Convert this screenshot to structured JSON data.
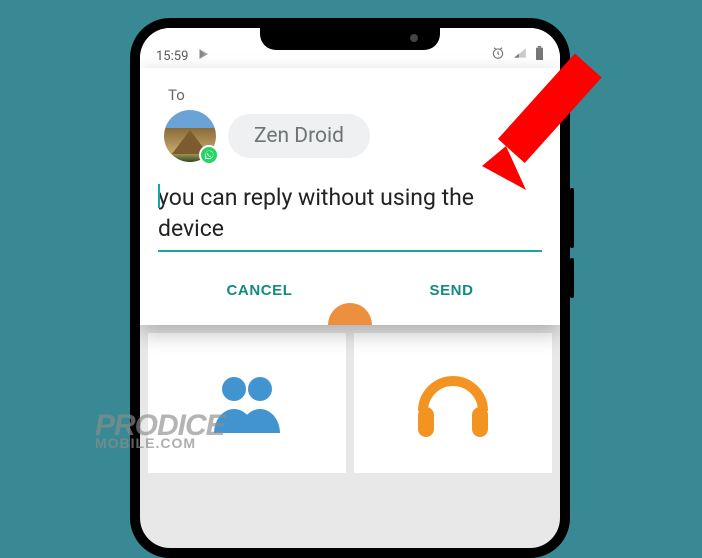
{
  "status_bar": {
    "time": "15:59",
    "alarm_on": true,
    "signal_icon": "signal",
    "battery_icon": "battery"
  },
  "dialog": {
    "to_label": "To",
    "recipient_name": "Zen Droid",
    "message_text": "you can reply without using the device",
    "cancel_label": "CANCEL",
    "send_label": "SEND"
  },
  "watermark": {
    "line1": "PRODICE",
    "line2": "MOBILE.COM"
  },
  "app_tiles": {
    "contacts": "Contacts",
    "music": "Music"
  }
}
